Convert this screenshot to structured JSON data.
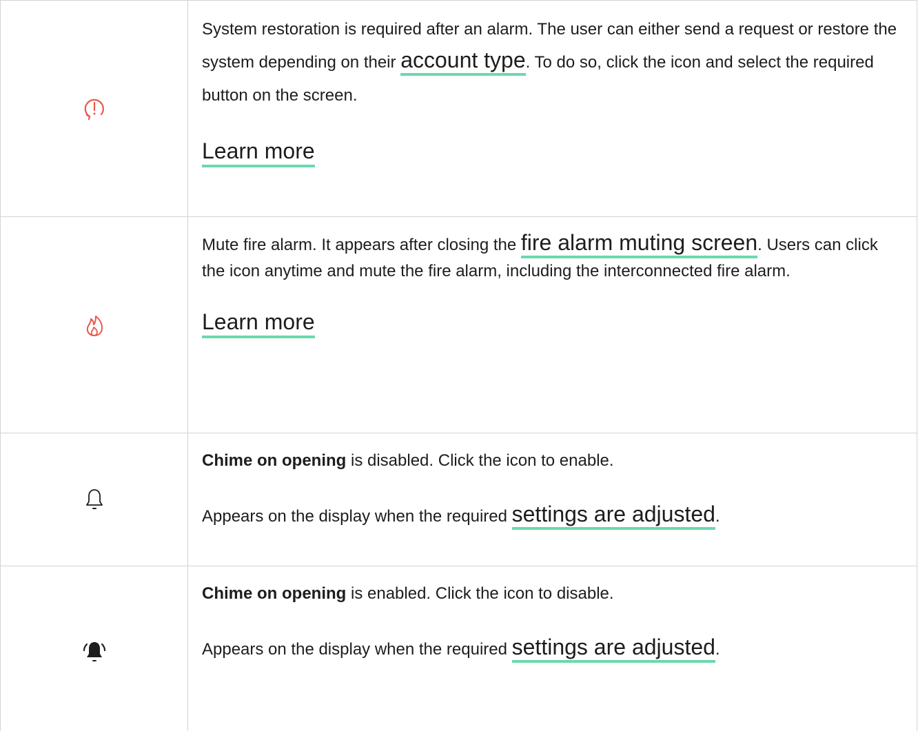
{
  "colors": {
    "border": "#d3d3d3",
    "link_underline": "#6ad9ac",
    "alert_icon": "#e8574a",
    "text": "#1d1d1d"
  },
  "rows": [
    {
      "icon": "alarm-restore-icon",
      "text_before": "System restoration is required after an alarm. The user can either send a request or restore the system depending on their ",
      "link": "account type",
      "text_after": ". To do so, click the icon and select the required button on the screen.",
      "learn_more": "Learn more"
    },
    {
      "icon": "fire-icon",
      "text_before": "Mute fire alarm. It appears after closing the ",
      "link": "fire alarm muting screen",
      "text_after": ". Users can click the icon anytime and mute the fire alarm, including the interconnected fire alarm.",
      "learn_more": "Learn more"
    },
    {
      "icon": "bell-outline-icon",
      "bold": "Chime on opening",
      "text_after_bold": " is disabled. Click the icon to enable.",
      "sub_before": "Appears on the display when the required ",
      "sub_link": "settings are adjusted",
      "sub_after": "."
    },
    {
      "icon": "bell-ringing-icon",
      "bold": "Chime on opening",
      "text_after_bold": " is enabled. Click the icon to disable.",
      "sub_before": "Appears on the display when the required ",
      "sub_link": "settings are adjusted",
      "sub_after": "."
    }
  ]
}
